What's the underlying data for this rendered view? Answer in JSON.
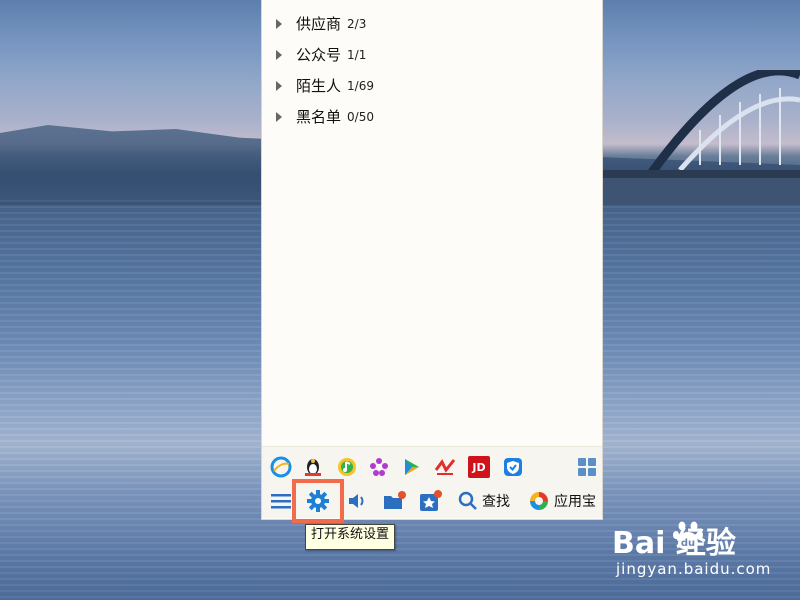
{
  "contacts_panel": {
    "groups": [
      {
        "name": "供应商",
        "count": "2/3"
      },
      {
        "name": "公众号",
        "count": "1/1"
      },
      {
        "name": "陌生人",
        "count": "1/69"
      },
      {
        "name": "黑名单",
        "count": "0/50"
      }
    ],
    "app_icons": [
      "browser-icon",
      "penguin-game-icon",
      "qq-music-icon",
      "flower-icon",
      "video-player-icon",
      "wave-app-icon",
      "jd-icon",
      "security-shield-icon",
      "grid-apps-icon"
    ],
    "app_icon_labels": {
      "jd": "JD"
    },
    "bottom_bar": {
      "search_label": "查找",
      "app_store_label": "应用宝"
    },
    "tooltip": "打开系统设置"
  },
  "watermark": {
    "brand": "Bai  经验",
    "site": "jingyan.baidu.com"
  },
  "colors": {
    "highlight_border": "#f26b4a",
    "tooltip_bg": "#ffffe1",
    "settings_icon": "#1e7fd6"
  }
}
